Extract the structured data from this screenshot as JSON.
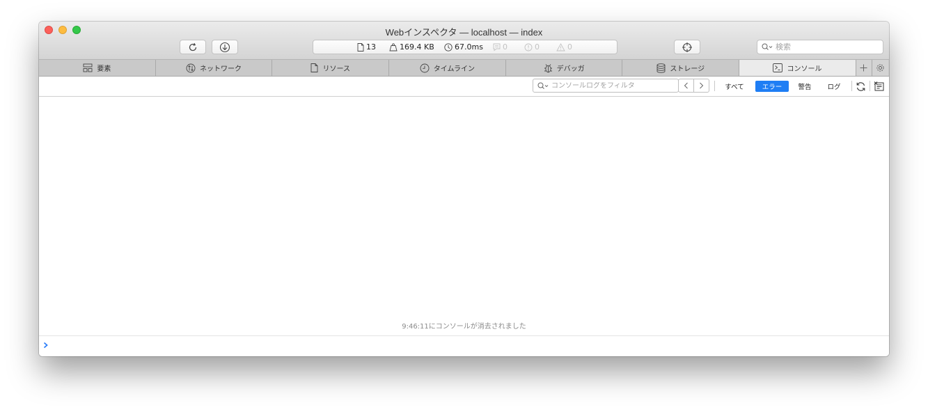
{
  "window": {
    "title": "Webインスペクタ — localhost — index"
  },
  "toolbar": {
    "reload_icon": "reload-icon",
    "download_icon": "download-icon",
    "target_icon": "crosshair-icon"
  },
  "activity": {
    "resources": "13",
    "size": "169.4 KB",
    "time": "67.0ms",
    "logs": "0",
    "errors": "0",
    "warnings": "0"
  },
  "search": {
    "placeholder": "検索"
  },
  "tabs": [
    {
      "label": "要素",
      "icon": "elements-icon"
    },
    {
      "label": "ネットワーク",
      "icon": "network-icon"
    },
    {
      "label": "リソース",
      "icon": "resource-icon"
    },
    {
      "label": "タイムライン",
      "icon": "timeline-icon"
    },
    {
      "label": "デバッガ",
      "icon": "debugger-icon"
    },
    {
      "label": "ストレージ",
      "icon": "storage-icon"
    },
    {
      "label": "コンソール",
      "icon": "console-icon",
      "active": true
    }
  ],
  "console": {
    "filter_placeholder": "コンソールログをフィルタ",
    "levels": {
      "all": "すべて",
      "errors": "エラー",
      "warnings": "警告",
      "logs": "ログ"
    },
    "active_level": "errors",
    "cleared_message": "9:46:11にコンソールが消去されました",
    "prompt_value": ""
  },
  "colors": {
    "accent": "#1f7ef4",
    "close": "#fc605b",
    "minimize": "#fdbc40",
    "maximize": "#34c84a"
  }
}
